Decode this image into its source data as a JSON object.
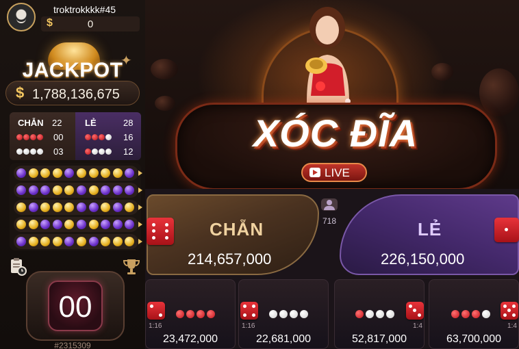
{
  "player": {
    "username": "troktrokkkk#45",
    "balance": "0",
    "currency_symbol": "$"
  },
  "jackpot": {
    "title": "JACKPOT",
    "currency_symbol": "$",
    "amount": "1,788,136,675"
  },
  "stats": {
    "even": {
      "label": "CHẴN",
      "count": "22",
      "rows": [
        {
          "pattern": [
            "r",
            "r",
            "r",
            "r"
          ],
          "value": "00"
        },
        {
          "pattern": [
            "w",
            "w",
            "w",
            "w"
          ],
          "value": "03"
        }
      ]
    },
    "odd": {
      "label": "LẺ",
      "count": "28",
      "rows": [
        {
          "pattern": [
            "r",
            "r",
            "r",
            "w"
          ],
          "value": "16"
        },
        {
          "pattern": [
            "r",
            "w",
            "w",
            "w"
          ],
          "value": "12"
        }
      ]
    }
  },
  "history_rows": [
    [
      "p",
      "g",
      "g",
      "g",
      "p",
      "g",
      "g",
      "g",
      "g",
      "p"
    ],
    [
      "p",
      "p",
      "p",
      "g",
      "g",
      "p",
      "g",
      "p",
      "p",
      "p"
    ],
    [
      "g",
      "p",
      "g",
      "g",
      "g",
      "p",
      "p",
      "g",
      "p",
      "g"
    ],
    [
      "g",
      "g",
      "p",
      "p",
      "g",
      "p",
      "g",
      "p",
      "p",
      "p"
    ],
    [
      "p",
      "g",
      "g",
      "g",
      "p",
      "g",
      "p",
      "g",
      "g",
      "g"
    ]
  ],
  "timer": {
    "countdown": "00",
    "session_id": "#2315309"
  },
  "game": {
    "logo_text": "XÓC ĐĨA",
    "live_label": "LIVE"
  },
  "bets": {
    "even": {
      "label": "CHẴN",
      "total": "214,657,000",
      "color": "#f0d2a0"
    },
    "odd": {
      "label": "LẺ",
      "total": "226,150,000",
      "color": "#e0ccff"
    },
    "players_online": "718"
  },
  "sub_bets": [
    {
      "ratio": "1:16",
      "chips": [
        "r",
        "r",
        "r",
        "r"
      ],
      "total": "23,472,000"
    },
    {
      "ratio": "1:16",
      "chips": [
        "w",
        "w",
        "w",
        "w"
      ],
      "total": "22,681,000"
    },
    {
      "ratio": "1:4",
      "chips": [
        "r",
        "w",
        "w",
        "w"
      ],
      "total": "52,817,000"
    },
    {
      "ratio": "1:4",
      "chips": [
        "r",
        "r",
        "r",
        "w"
      ],
      "total": "63,700,000"
    }
  ],
  "icons": [
    "avatar-anonymous-mask",
    "dollar-icon",
    "jackpot-pot-icon",
    "star-icon",
    "history-clipboard-icon",
    "trophy-icon",
    "users-icon",
    "live-play-icon",
    "dice-icon"
  ],
  "colors": {
    "gold": "#f2c560",
    "red": "#c0342a",
    "purple": "#5e3a8a"
  }
}
